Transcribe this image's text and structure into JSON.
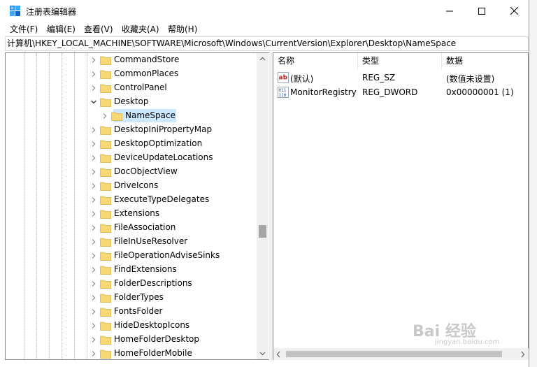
{
  "window": {
    "title": "注册表编辑器"
  },
  "menu": [
    "文件(F)",
    "编辑(E)",
    "查看(V)",
    "收藏夹(A)",
    "帮助(H)"
  ],
  "address": "计算机\\HKEY_LOCAL_MACHINE\\SOFTWARE\\Microsoft\\Windows\\CurrentVersion\\Explorer\\Desktop\\NameSpace",
  "tree": [
    {
      "label": "CommandStore"
    },
    {
      "label": "CommonPlaces"
    },
    {
      "label": "ControlPanel"
    },
    {
      "label": "Desktop",
      "expanded": true
    },
    {
      "label": "NameSpace",
      "selected": true
    },
    {
      "label": "DesktopIniPropertyMap"
    },
    {
      "label": "DesktopOptimization"
    },
    {
      "label": "DeviceUpdateLocations"
    },
    {
      "label": "DocObjectView"
    },
    {
      "label": "DriveIcons"
    },
    {
      "label": "ExecuteTypeDelegates"
    },
    {
      "label": "Extensions"
    },
    {
      "label": "FileAssociation"
    },
    {
      "label": "FileInUseResolver"
    },
    {
      "label": "FileOperationAdviseSinks"
    },
    {
      "label": "FindExtensions"
    },
    {
      "label": "FolderDescriptions"
    },
    {
      "label": "FolderTypes"
    },
    {
      "label": "FontsFolder"
    },
    {
      "label": "HideDesktopIcons"
    },
    {
      "label": "HomeFolderDesktop"
    },
    {
      "label": "HomeFolderMobile"
    }
  ],
  "columns": {
    "name": "名称",
    "type": "类型",
    "data": "数据"
  },
  "values": [
    {
      "name": "(默认)",
      "type": "REG_SZ",
      "data": "(数值未设置)",
      "icon": "string-value-icon"
    },
    {
      "name": "MonitorRegistry",
      "type": "REG_DWORD",
      "data": "0x00000001 (1)",
      "icon": "binary-value-icon"
    }
  ],
  "watermark": {
    "main": "Bai 经验",
    "sub": "jingyan.baidu.com"
  },
  "colors": {
    "selection": "#cce8ff",
    "folder": "#f8d775",
    "scrollbar": "#f0f0f0"
  }
}
